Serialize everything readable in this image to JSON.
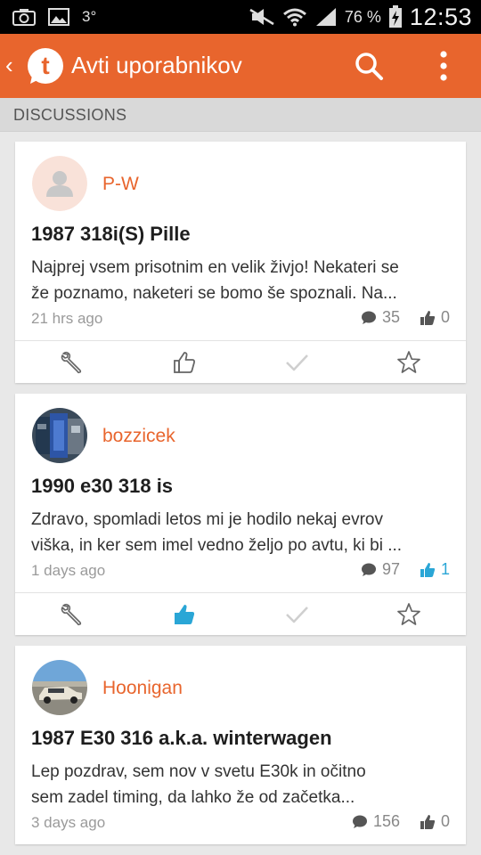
{
  "status_bar": {
    "temperature": "3°",
    "battery_percent": "76 %",
    "time": "12:53"
  },
  "app_bar": {
    "title": "Avti uporabnikov",
    "logo_letter": "t"
  },
  "section": {
    "title": "DISCUSSIONS"
  },
  "colors": {
    "accent": "#e8652d",
    "liked_blue": "#2aa6d6"
  },
  "discussions": [
    {
      "username": "P-W",
      "title": "1987 318i(S) Pille",
      "excerpt_line1": "Najprej vsem prisotnim en velik živjo! Nekateri se",
      "excerpt_line2": "že poznamo, naketeri se bomo še spoznali. Na...",
      "time": "21 hrs ago",
      "comments": "35",
      "likes": "0",
      "liked": false,
      "avatar": "placeholder-user-icon"
    },
    {
      "username": "bozzicek",
      "title": "1990 e30 318 is",
      "excerpt_line1": "Zdravo, spomladi letos mi je hodilo nekaj evrov",
      "excerpt_line2": "viška, in ker sem imel vedno željo po avtu, ki bi ...",
      "time": "1 days ago",
      "comments": "97",
      "likes": "1",
      "liked": true,
      "avatar": "engine-photo"
    },
    {
      "username": "Hoonigan",
      "title": "1987 E30 316 a.k.a. winterwagen",
      "excerpt_line1": "Lep pozdrav, sem nov v svetu E30k in očitno",
      "excerpt_line2": "sem zadel timing, da lahko že od začetka...",
      "time": "3 days ago",
      "comments": "156",
      "likes": "0",
      "liked": false,
      "avatar": "car-photo"
    }
  ]
}
